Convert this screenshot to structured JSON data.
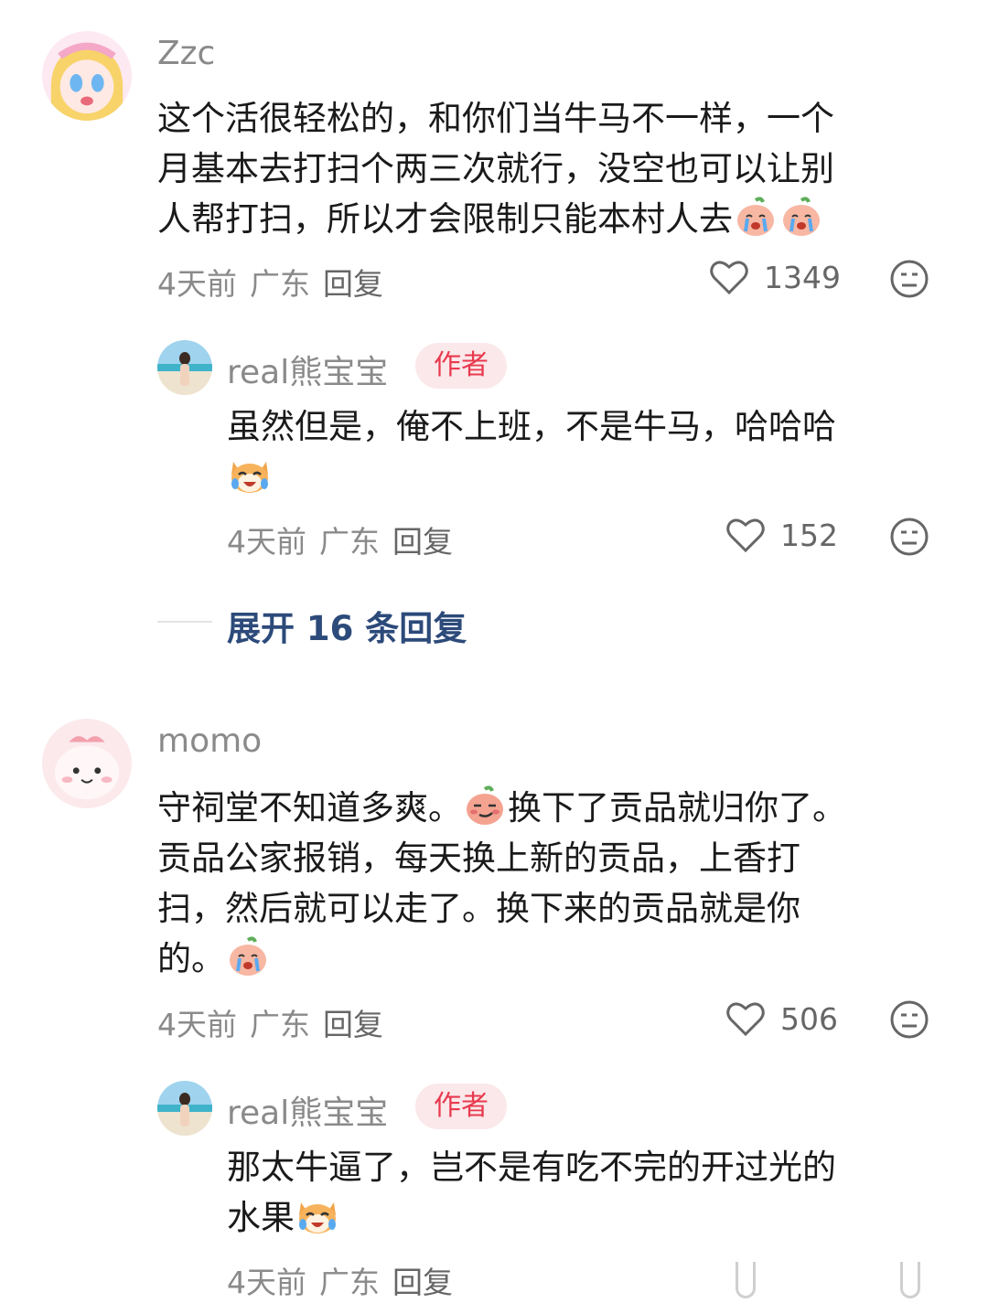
{
  "comments": [
    {
      "username": "Zzc",
      "text_lines": [
        "这个活很轻松的，和你们当牛马不一样，一个",
        "月基本去打扫个两三次就行，没空也可以让别",
        "人帮打扫，所以才会限制只能本村人去"
      ],
      "time": "4天前",
      "location": "广东",
      "reply_label": "回复",
      "likes": "1349"
    },
    {
      "username": "real熊宝宝",
      "badge": "作者",
      "text_lines": [
        "虽然但是，俺不上班，不是牛马，哈哈哈",
        ""
      ],
      "time": "4天前",
      "location": "广东",
      "reply_label": "回复",
      "likes": "152"
    },
    {
      "username": "momo",
      "text_lines": [
        "守祠堂不知道多爽。",
        "换下了贡品就归你了。",
        "贡品公家报销，每天换上新的贡品，上香打",
        "扫，然后就可以走了。换下来的贡品就是你",
        "的。"
      ],
      "time": "4天前",
      "location": "广东",
      "reply_label": "回复",
      "likes": "506"
    },
    {
      "username": "real熊宝宝",
      "badge": "作者",
      "text_lines": [
        "那太牛逼了，岂不是有吃不完的开过光的",
        "水果"
      ],
      "time": "4天前",
      "location": "广东",
      "reply_label": "回复"
    }
  ],
  "expand_replies": "展开 16 条回复",
  "icons": {
    "like": "heart-outline-icon",
    "dislike": "meh-face-icon",
    "emoji_cry": "crying-peach-emoji",
    "emoji_cat": "laughing-cat-emoji",
    "emoji_smirk": "smirking-peach-emoji"
  },
  "colors": {
    "author_badge_bg": "#fbe8ea",
    "author_badge_text": "#e83a4f",
    "link": "#2c4a7a",
    "meta": "#8a8a8a"
  }
}
